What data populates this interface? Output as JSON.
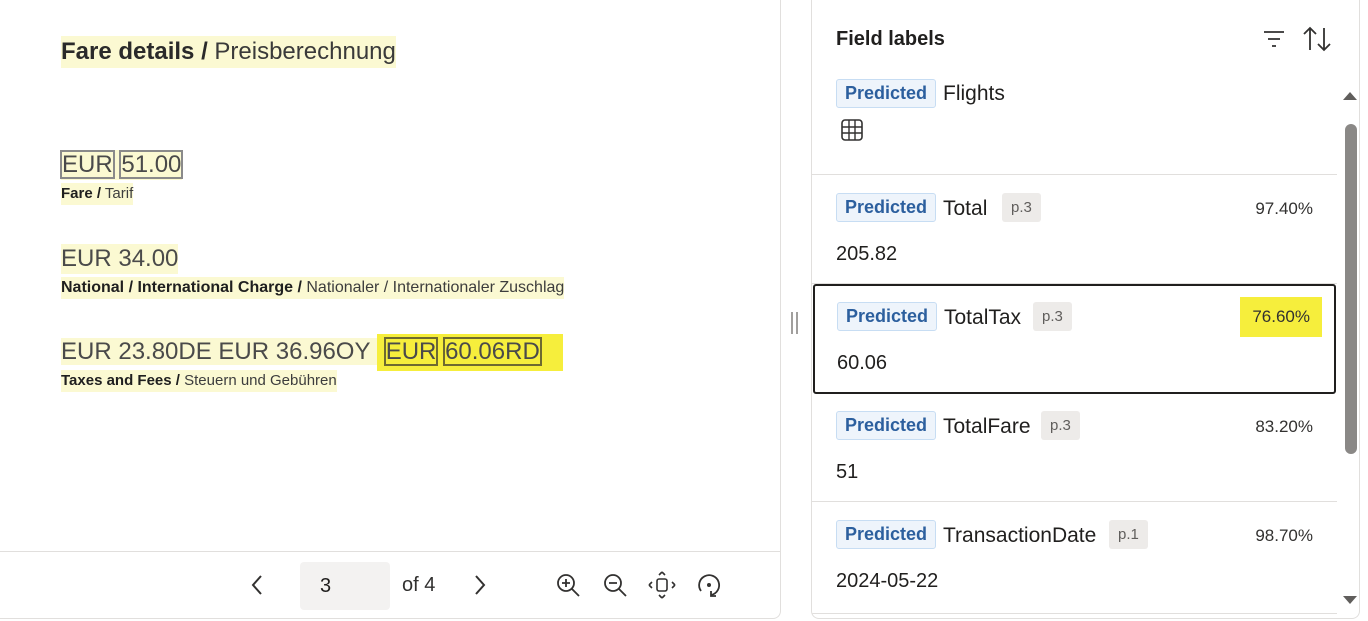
{
  "document": {
    "title_bold": "Fare details /",
    "title_rest": " Preisberechnung",
    "fare": {
      "currency": "EUR",
      "amount": "51.00",
      "label_bold": "Fare /",
      "label_rest": " Tarif"
    },
    "charge": {
      "amount_text": "EUR 34.00",
      "label_bold": "National / International Charge /",
      "label_rest": " Nationaler / Internationaler Zuschlag"
    },
    "taxes": {
      "amount_prefix": "EUR 23.80DE EUR 36.96OY ",
      "currency": "EUR",
      "amount": "60.06RD",
      "label_bold": "Taxes and Fees /",
      "label_rest": " Steuern und Gebühren"
    },
    "highlight_color": "#f6ee3c"
  },
  "pager": {
    "current_page": "3",
    "of_text": "of 4",
    "icons": [
      "chevron-left-icon",
      "chevron-right-icon",
      "zoom-in-icon",
      "zoom-out-icon",
      "fit-page-icon",
      "rotate-icon"
    ]
  },
  "panel": {
    "title": "Field labels",
    "icons": [
      "filter-icon",
      "sort-icon"
    ],
    "fields": [
      {
        "status": "Predicted",
        "name": "Flights",
        "page": "",
        "confidence": "",
        "value": "",
        "is_table": true
      },
      {
        "status": "Predicted",
        "name": "Total",
        "page": "p.3",
        "confidence": "97.40%",
        "value": "205.82"
      },
      {
        "status": "Predicted",
        "name": "TotalTax",
        "page": "p.3",
        "confidence": "76.60%",
        "value": "60.06",
        "active": true
      },
      {
        "status": "Predicted",
        "name": "TotalFare",
        "page": "p.3",
        "confidence": "83.20%",
        "value": "51"
      },
      {
        "status": "Predicted",
        "name": "TransactionDate",
        "page": "p.1",
        "confidence": "98.70%",
        "value": "2024-05-22"
      }
    ],
    "accent_color": "#2c5f9e"
  }
}
